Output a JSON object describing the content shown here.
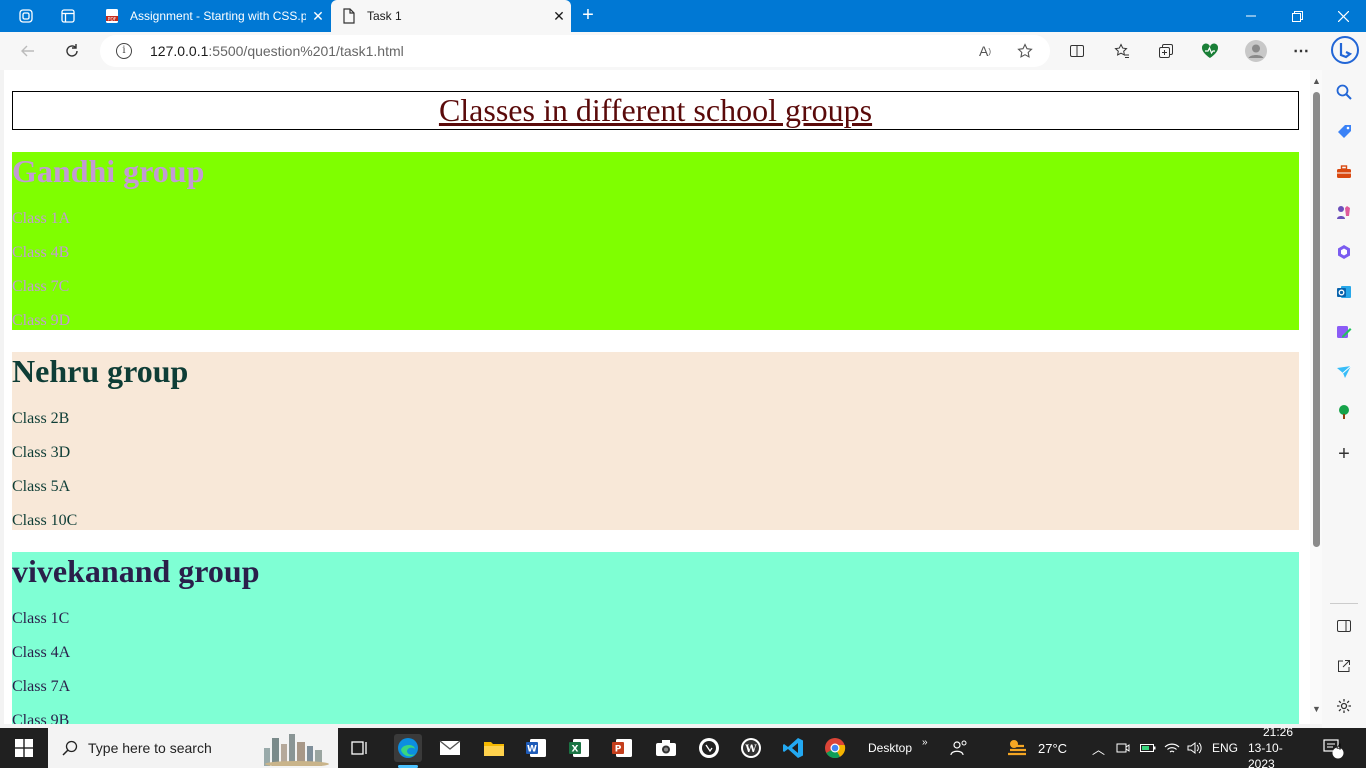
{
  "browser": {
    "tabs": [
      {
        "label": "Assignment - Starting with CSS.p",
        "active": false,
        "favicon": "pdf-icon"
      },
      {
        "label": "Task 1",
        "active": true,
        "favicon": "page-icon"
      }
    ],
    "url_host": "127.0.0.1",
    "url_path": ":5500/question%201/task1.html"
  },
  "page": {
    "title": "Classes in different school groups",
    "groups": [
      {
        "name": "Gandhi group",
        "bg": "#7fff00",
        "color": "#c39bd3",
        "classes": [
          "Class 1A",
          "Class 4B",
          "Class 7C",
          "Class 9D"
        ]
      },
      {
        "name": "Nehru group",
        "bg": "#f8e8d8",
        "color": "#0e3d36",
        "classes": [
          "Class 2B",
          "Class 3D",
          "Class 5A",
          "Class 10C"
        ]
      },
      {
        "name": "vivekanand group",
        "bg": "#7fffd4",
        "color": "#2a1f4a",
        "classes": [
          "Class 1C",
          "Class 4A",
          "Class 7A",
          "Class 9B"
        ]
      }
    ]
  },
  "taskbar": {
    "search_placeholder": "Type here to search",
    "desktop_label": "Desktop",
    "weather": "27°C",
    "language": "ENG",
    "time": "21:26",
    "date": "13-10-2023",
    "notifications": "4"
  }
}
